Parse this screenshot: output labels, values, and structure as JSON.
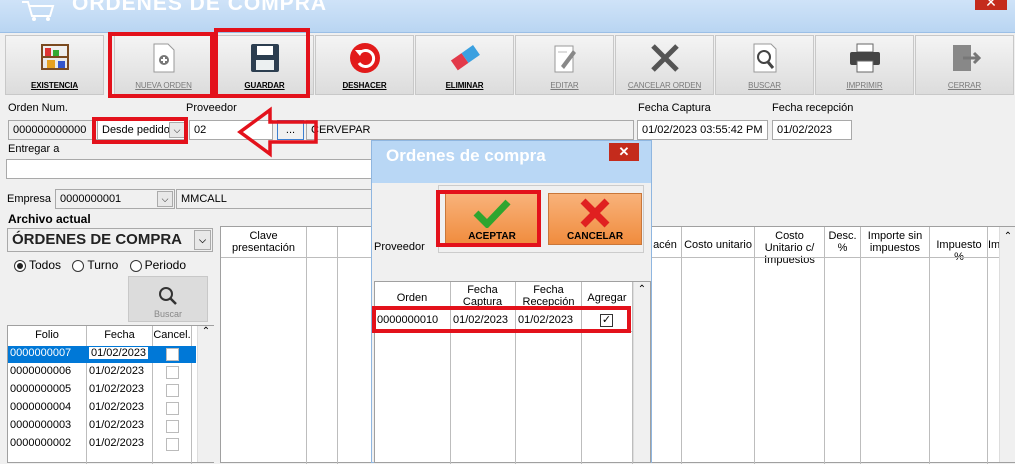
{
  "window": {
    "title": "ÓRDENES DE COMPRA",
    "close": "✕"
  },
  "toolbar": [
    {
      "label": "EXISTENCIA",
      "enabled": true,
      "icon": "shelf-icon"
    },
    {
      "label": "NUEVA ORDEN",
      "enabled": false,
      "icon": "new-document-icon"
    },
    {
      "label": "GUARDAR",
      "enabled": true,
      "icon": "floppy-disk-icon"
    },
    {
      "label": "DESHACER",
      "enabled": true,
      "icon": "undo-icon"
    },
    {
      "label": "ELIMINAR",
      "enabled": true,
      "icon": "eraser-icon"
    },
    {
      "label": "EDITAR",
      "enabled": false,
      "icon": "edit-icon"
    },
    {
      "label": "CANCELAR ORDEN",
      "enabled": false,
      "icon": "x-icon"
    },
    {
      "label": "BUSCAR",
      "enabled": false,
      "icon": "search-icon"
    },
    {
      "label": "IMPRIMIR",
      "enabled": false,
      "icon": "printer-icon"
    },
    {
      "label": "CERRAR",
      "enabled": false,
      "icon": "exit-door-icon"
    }
  ],
  "form": {
    "orden_num_label": "Orden Num.",
    "orden_num_value": "000000000000",
    "tipo_value": "Desde pedido",
    "proveedor_label": "Proveedor",
    "proveedor_code": "02",
    "proveedor_browse": "...",
    "proveedor_name": "CERVEPAR",
    "fecha_captura_label": "Fecha Captura",
    "fecha_captura_value": "01/02/2023 03:55:42 PM",
    "fecha_recepcion_label": "Fecha recepción",
    "fecha_recepcion_value": "01/02/2023",
    "entregar_label": "Entregar a",
    "entregar_value": "",
    "empresa_label": "Empresa",
    "empresa_code": "0000000001",
    "empresa_name": "MMCALL"
  },
  "archivo": {
    "label": "Archivo actual",
    "value": "ÓRDENES DE COMPRA",
    "radios": [
      {
        "label": "Todos",
        "checked": true
      },
      {
        "label": "Turno",
        "checked": false
      },
      {
        "label": "Periodo",
        "checked": false
      }
    ],
    "buscar": "Buscar",
    "columns": [
      "Folio",
      "Fecha",
      "Cancel."
    ],
    "rows": [
      {
        "folio": "0000000007",
        "fecha": "01/02/2023",
        "selected": true
      },
      {
        "folio": "0000000006",
        "fecha": "01/02/2023",
        "selected": false
      },
      {
        "folio": "0000000005",
        "fecha": "01/02/2023",
        "selected": false
      },
      {
        "folio": "0000000004",
        "fecha": "01/02/2023",
        "selected": false
      },
      {
        "folio": "0000000003",
        "fecha": "01/02/2023",
        "selected": false
      },
      {
        "folio": "0000000002",
        "fecha": "01/02/2023",
        "selected": false
      }
    ]
  },
  "main_grid": {
    "columns": [
      "Clave presentación",
      "acén",
      "Costo unitario",
      "Costo Unitario c/ Impuestos",
      "Desc. %",
      "Importe sin impuestos",
      "Impuesto %",
      "Im"
    ]
  },
  "modal": {
    "title": "Ordenes de compra",
    "close": "✕",
    "aceptar": "ACEPTAR",
    "cancelar": "CANCELAR",
    "proveedor_label": "Proveedor",
    "columns": [
      "Orden",
      "Fecha Captura",
      "Fecha Recepción",
      "Agregar"
    ],
    "rows": [
      {
        "orden": "0000000010",
        "captura": "01/02/2023",
        "recepcion": "01/02/2023",
        "agregar": true
      }
    ]
  }
}
